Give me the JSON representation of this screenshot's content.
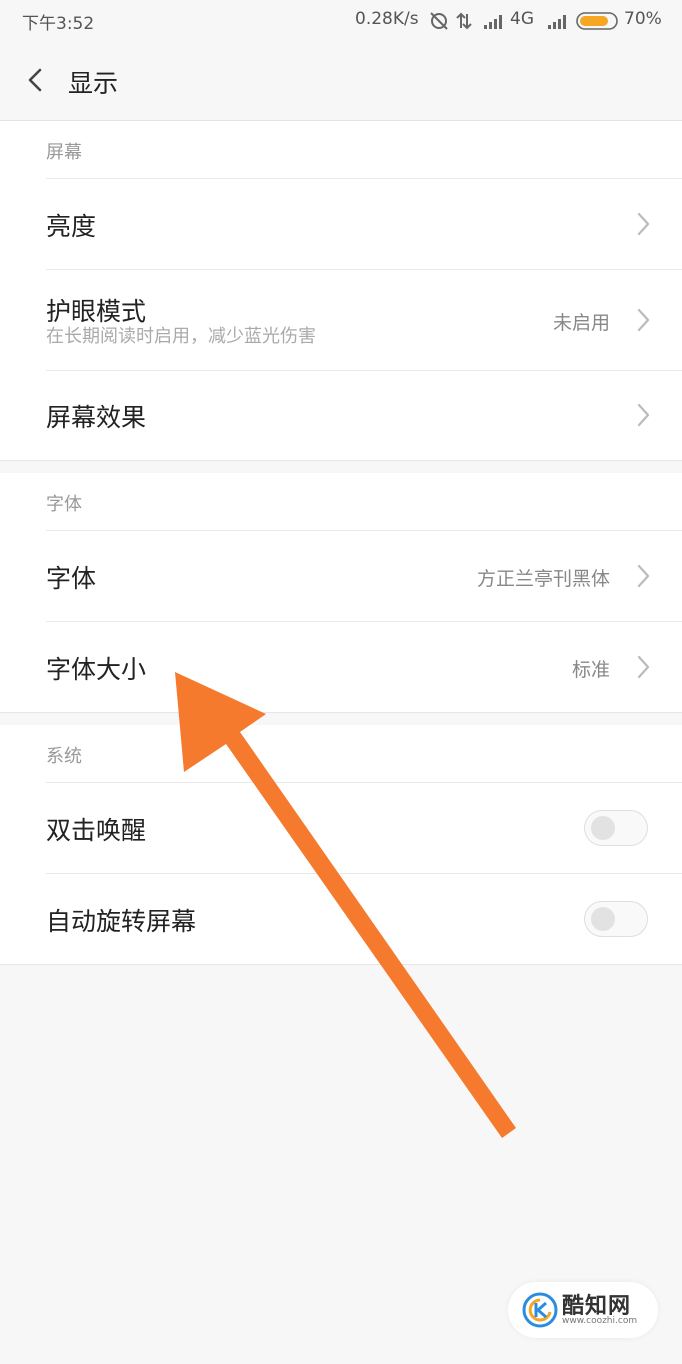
{
  "status_bar": {
    "time": "下午3:52",
    "speed": "0.28K/s",
    "network": "4G",
    "battery": "70%",
    "battery_color": "#f5a623"
  },
  "header": {
    "title": "显示"
  },
  "sections": {
    "screen": {
      "title": "屏幕",
      "items": [
        {
          "label": "亮度"
        },
        {
          "label": "护眼模式",
          "sublabel": "在长期阅读时启用，减少蓝光伤害",
          "value": "未启用"
        },
        {
          "label": "屏幕效果"
        }
      ]
    },
    "font": {
      "title": "字体",
      "items": [
        {
          "label": "字体",
          "value": "方正兰亭刊黑体"
        },
        {
          "label": "字体大小",
          "value": "标准"
        }
      ]
    },
    "system": {
      "title": "系统",
      "items": [
        {
          "label": "双击唤醒",
          "toggle": false
        },
        {
          "label": "自动旋转屏幕",
          "toggle": false
        }
      ]
    }
  },
  "annotation": {
    "arrow_color": "#f57a2e"
  },
  "watermark": {
    "name": "酷知网",
    "url": "www.coozhi.com"
  }
}
